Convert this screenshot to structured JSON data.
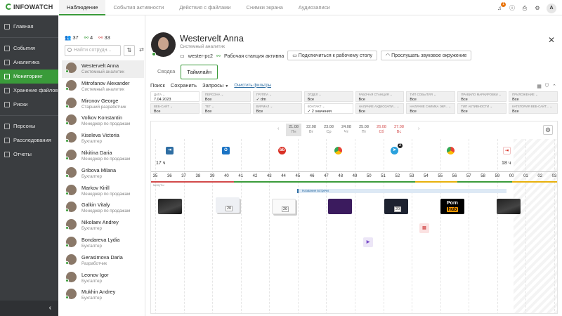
{
  "app": {
    "logo": "INFOWATCH",
    "avatar_letter": "A",
    "notif_count": "1"
  },
  "tabs": [
    "Наблюдение",
    "События активности",
    "Действия с файлами",
    "Снимки экрана",
    "Аудиозаписи"
  ],
  "nav": {
    "items": [
      "Главная",
      "События",
      "Аналитика",
      "Мониторинг",
      "Хранение файлов",
      "Риски",
      "Персоны",
      "Расследования",
      "Отчеты"
    ],
    "active": "Мониторинг"
  },
  "persons": {
    "counts": {
      "total": "37",
      "online": "4",
      "offline": "33"
    },
    "search_placeholder": "Найти сотрудн...",
    "list": [
      {
        "name": "Westervelt Anna",
        "role": "Системный аналитик"
      },
      {
        "name": "Mitrofanov Alexander",
        "role": "Системный аналитик"
      },
      {
        "name": "Mironov George",
        "role": "Старший разработчик"
      },
      {
        "name": "Volkov Konstantin",
        "role": "Менеджер по продажам"
      },
      {
        "name": "Kiseleva Victoria",
        "role": "Бухгалтер"
      },
      {
        "name": "Nikitina Daria",
        "role": "Менеджер по продажам"
      },
      {
        "name": "Gribova Milana",
        "role": "Бухгалтер"
      },
      {
        "name": "Markov Kirill",
        "role": "Менеджер по продажам"
      },
      {
        "name": "Galkin Vitaly",
        "role": "Менеджер по продажам"
      },
      {
        "name": "Nikolaev Andrey",
        "role": "Бухгалтер"
      },
      {
        "name": "Bondareva Lydia",
        "role": "Бухгалтер"
      },
      {
        "name": "Gerasimova Daria",
        "role": "Разработчик"
      },
      {
        "name": "Leonov Igor",
        "role": "Бухгалтер"
      },
      {
        "name": "Mukhin Andrey",
        "role": "Бухгалтер"
      }
    ]
  },
  "user": {
    "name": "Westervelt Anna",
    "role": "Системный аналитик",
    "pc": "wester-pc2",
    "status": "Рабочая станция активна",
    "connect_btn": "Подключиться к рабочему столу",
    "listen_btn": "Прослушать звуковое окружение"
  },
  "view_tabs": [
    "Сводка",
    "Таймлайн"
  ],
  "toolbar": {
    "search": "Поиск",
    "save": "Сохранить",
    "queries": "Запросы",
    "clear": "Очистить фильтры"
  },
  "filters": [
    [
      {
        "label": "Дата",
        "value": "7.04.2023"
      },
      {
        "label": "Персона",
        "value": "Все"
      },
      {
        "label": "Группа",
        "value": "✓ dm"
      },
      {
        "label": "Отдел",
        "value": "Все"
      },
      {
        "label": "Рабочая станция",
        "value": "Все"
      },
      {
        "label": "Тип события",
        "value": "Все"
      },
      {
        "label": "Правило маркировки",
        "value": "Все"
      },
      {
        "label": "Приложение",
        "value": "Все"
      }
    ],
    [
      {
        "label": "Веб-сайт",
        "value": "Все"
      },
      {
        "label": "Тег",
        "value": "Все"
      },
      {
        "label": "Вирмал",
        "value": "Все"
      },
      {
        "label": "Контакт",
        "value": "✓ 2 значения"
      },
      {
        "label": "Наличие аудиозапи...",
        "value": "Все"
      },
      {
        "label": "Наличие снимка экр...",
        "value": "Все"
      },
      {
        "label": "Тип активности",
        "value": "Все"
      },
      {
        "label": "Категория веб-сайт...",
        "value": "Все"
      }
    ]
  ],
  "timeline": {
    "days": [
      {
        "date": "21.08",
        "dow": "Пн",
        "active": true
      },
      {
        "date": "22.08",
        "dow": "Вт"
      },
      {
        "date": "23.08",
        "dow": "Ср"
      },
      {
        "date": "24.08",
        "dow": "Чт"
      },
      {
        "date": "25.08",
        "dow": "Пт"
      },
      {
        "date": "26.08",
        "dow": "Сб",
        "weekend": true
      },
      {
        "date": "27.08",
        "dow": "Вс",
        "weekend": true
      }
    ],
    "start_hour": "17 ч",
    "end_hour": "18 ч",
    "ticks": [
      "35",
      "36",
      "37",
      "38",
      "39",
      "40",
      "41",
      "42",
      "43",
      "44",
      "45",
      "46",
      "47",
      "48",
      "49",
      "50",
      "51",
      "52",
      "53",
      "54",
      "55",
      "56",
      "57",
      "58",
      "59",
      "00",
      "01",
      "02",
      "03"
    ],
    "minutes_label": "минуты",
    "meeting": "Название встречи",
    "screenshot_counts": [
      "20",
      "20",
      "20"
    ],
    "messenger_badge": "2",
    "porn_label_1": "Porn",
    "porn_label_2": "hub"
  },
  "colors": {
    "accent": "#3a9b3a",
    "nav_bg": "#3a3d40",
    "link": "#2f6ea3"
  }
}
